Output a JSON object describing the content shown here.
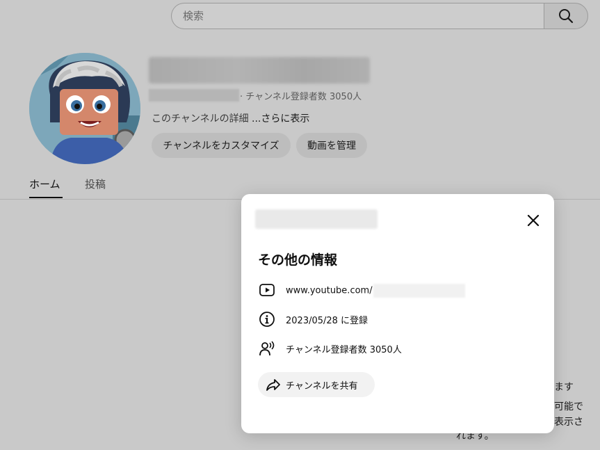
{
  "search": {
    "placeholder": "検索"
  },
  "channel": {
    "subscriber_line": "· チャンネル登録者数 3050人",
    "description": "このチャンネルの詳細 ",
    "description_more": "...さらに表示",
    "customize_label": "チャンネルをカスタマイズ",
    "manage_videos_label": "動画を管理"
  },
  "tabs": [
    {
      "label": "ホーム"
    },
    {
      "label": "投稿"
    }
  ],
  "background_text": [
    "ます",
    "可能で",
    "表示さ",
    "れます。"
  ],
  "modal": {
    "heading": "その他の情報",
    "url_prefix": "www.youtube.com/",
    "joined": "2023/05/28 に登録",
    "subscribers": "チャンネル登録者数 3050人",
    "share_label": "チャンネルを共有"
  },
  "colors": {
    "dim_background": "#c9c9c9",
    "modal_background": "#ffffff",
    "pill_background": "#bdbdbd",
    "share_background": "#f2f2f2"
  }
}
